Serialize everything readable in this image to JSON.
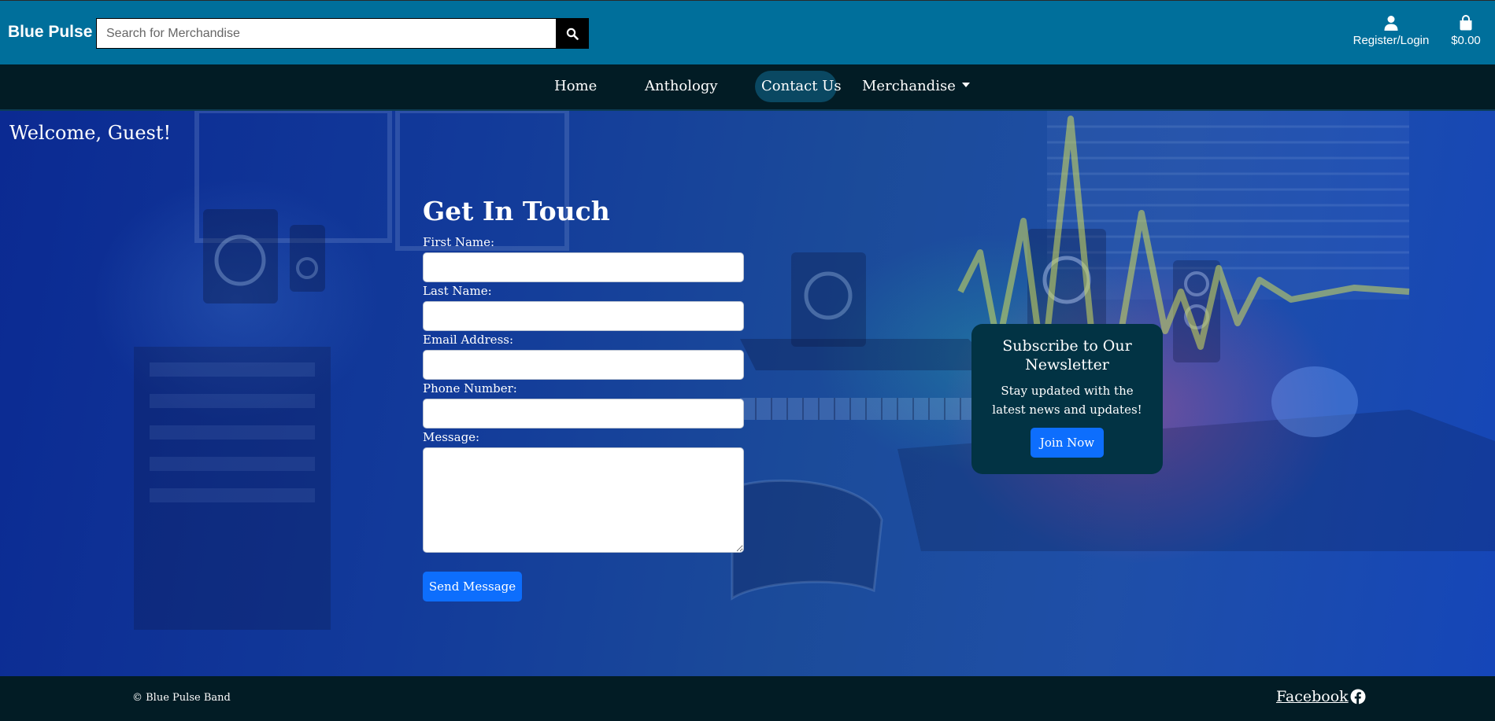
{
  "header": {
    "brand": "Blue Pulse",
    "search_placeholder": "Search for Merchandise",
    "account_label": "Register/Login",
    "cart_total": "$0.00"
  },
  "nav": {
    "items": [
      {
        "label": "Home"
      },
      {
        "label": "Anthology"
      },
      {
        "label": "Contact Us",
        "active": true
      },
      {
        "label": "Merchandise",
        "dropdown": true
      }
    ]
  },
  "hero": {
    "welcome": "Welcome, Guest!"
  },
  "contact_form": {
    "title": "Get In Touch",
    "fields": [
      {
        "label": "First Name:",
        "value": ""
      },
      {
        "label": "Last Name:",
        "value": ""
      },
      {
        "label": "Email Address:",
        "value": ""
      },
      {
        "label": "Phone Number:",
        "value": ""
      },
      {
        "label": "Message:",
        "value": ""
      }
    ],
    "submit_label": "Send Message"
  },
  "newsletter": {
    "title": "Subscribe to Our Newsletter",
    "text": "Stay updated with the latest news and updates!",
    "button_label": "Join Now"
  },
  "footer": {
    "copyright": "© Blue Pulse Band",
    "social_link": "Facebook"
  },
  "colors": {
    "header_bg": "#006f9b",
    "nav_bg": "#021c25",
    "nav_active": "#0a4862",
    "primary_button": "#0d6efd",
    "newsletter_bg": "#023344"
  },
  "icons": {
    "search": "search-icon",
    "account": "user-icon",
    "cart": "shopping-bag-icon",
    "facebook": "facebook-icon",
    "dropdown": "caret-down-icon"
  }
}
